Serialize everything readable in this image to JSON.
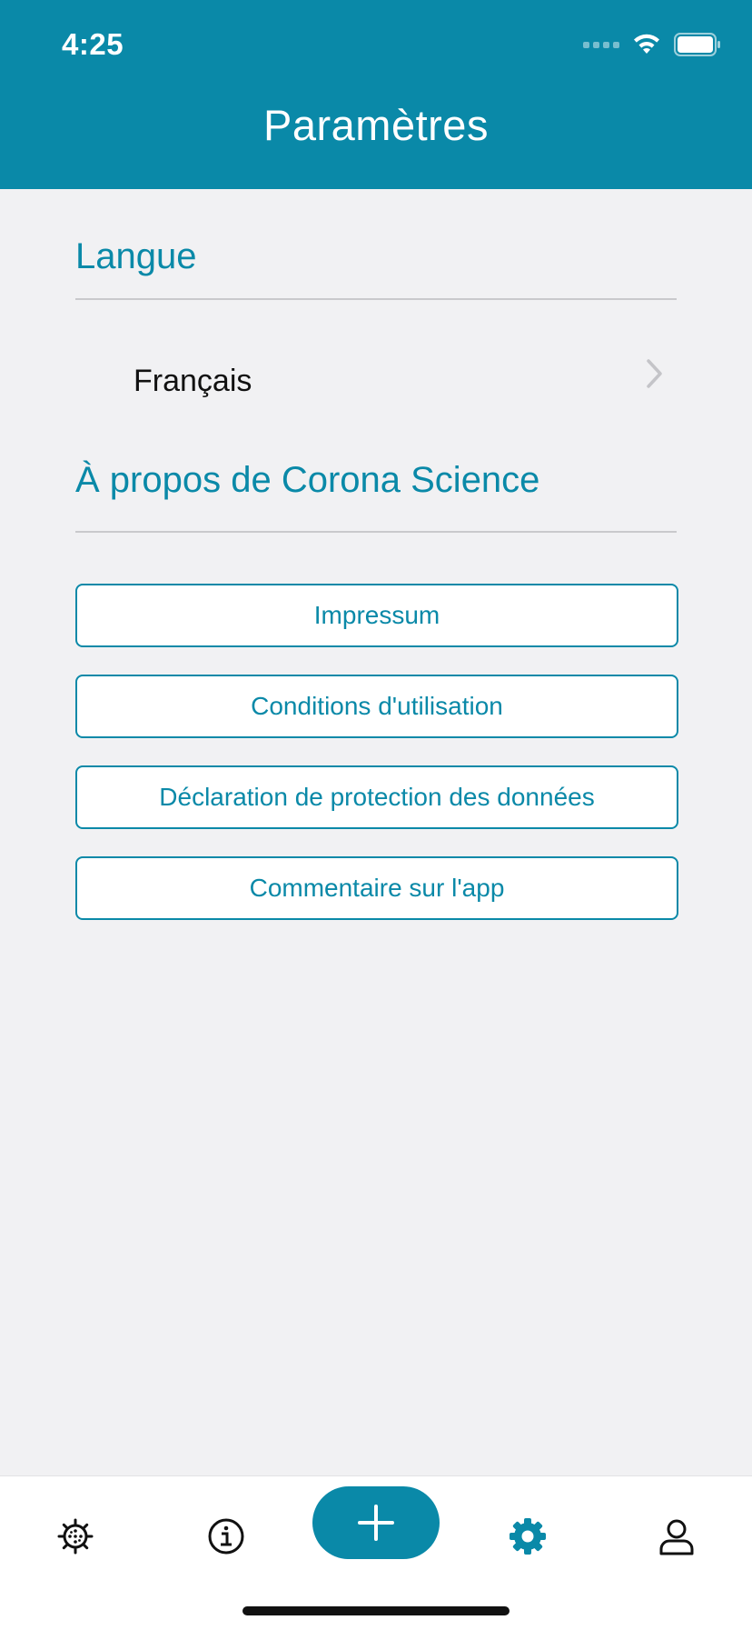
{
  "status_bar": {
    "time": "4:25"
  },
  "header": {
    "title": "Paramètres"
  },
  "language_section": {
    "title": "Langue",
    "selected": "Français"
  },
  "about_section": {
    "title": "À propos de Corona Science",
    "buttons": [
      "Impressum",
      "Conditions d'utilisation",
      "Déclaration de protection des données",
      "Commentaire sur l'app"
    ]
  },
  "tab_bar": {
    "items": [
      "virus-icon",
      "info-icon",
      "add-icon",
      "gear-icon",
      "user-icon"
    ],
    "active": "gear-icon",
    "accent": "#0a89a8"
  }
}
